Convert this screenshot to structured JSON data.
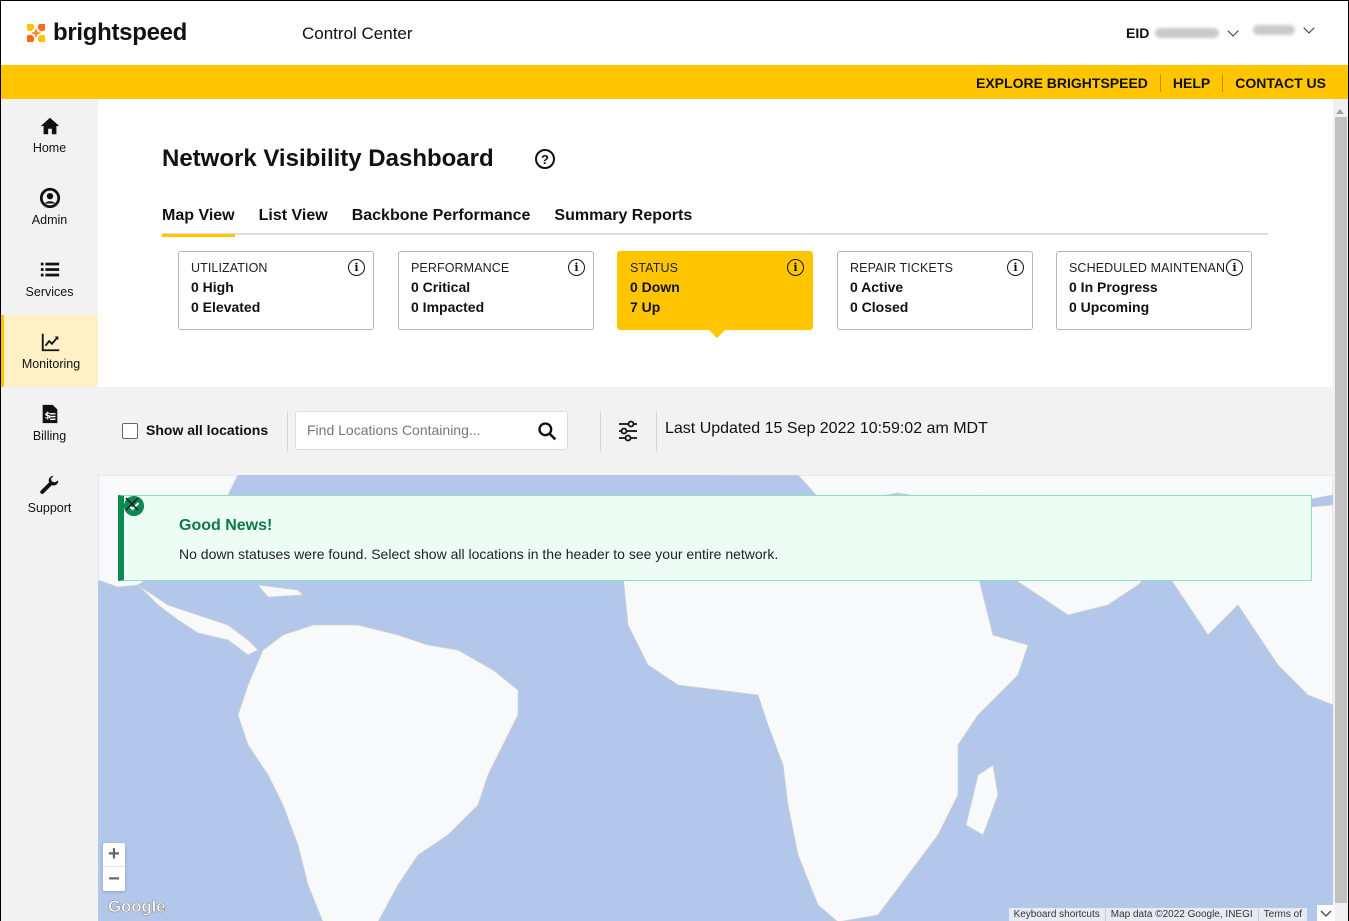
{
  "header": {
    "brand": "brightspeed",
    "app_title": "Control Center",
    "eid_label": "EID",
    "eid_value_redacted": true,
    "user_redacted": true
  },
  "utility_nav": {
    "links": [
      "EXPLORE BRIGHTSPEED",
      "HELP",
      "CONTACT US"
    ]
  },
  "sidebar": {
    "items": [
      {
        "label": "Home",
        "icon": "home-icon",
        "active": false
      },
      {
        "label": "Admin",
        "icon": "user-circle-icon",
        "active": false
      },
      {
        "label": "Services",
        "icon": "list-icon",
        "active": false
      },
      {
        "label": "Monitoring",
        "icon": "chart-trend-icon",
        "active": true
      },
      {
        "label": "Billing",
        "icon": "invoice-icon",
        "active": false
      },
      {
        "label": "Support",
        "icon": "wrench-icon",
        "active": false
      }
    ]
  },
  "page": {
    "title": "Network Visibility Dashboard",
    "help_icon": "?",
    "tabs": [
      {
        "label": "Map View",
        "active": true
      },
      {
        "label": "List View",
        "active": false
      },
      {
        "label": "Backbone Performance",
        "active": false
      },
      {
        "label": "Summary Reports",
        "active": false
      }
    ]
  },
  "cards": [
    {
      "title": "UTILIZATION",
      "lines": [
        "0 High",
        "0 Elevated"
      ],
      "active": false
    },
    {
      "title": "PERFORMANCE",
      "lines": [
        "0 Critical",
        "0 Impacted"
      ],
      "active": false
    },
    {
      "title": "STATUS",
      "lines": [
        "0 Down",
        "7 Up"
      ],
      "active": true
    },
    {
      "title": "REPAIR TICKETS",
      "lines": [
        "0 Active",
        "0 Closed"
      ],
      "active": false
    },
    {
      "title": "SCHEDULED MAINTENANCE",
      "lines": [
        "0 In Progress",
        "0 Upcoming"
      ],
      "active": false
    }
  ],
  "filters": {
    "show_all_label": "Show all locations",
    "show_all_checked": false,
    "search_placeholder": "Find Locations Containing...",
    "search_value": "",
    "last_updated": "Last Updated 15 Sep 2022 10:59:02 am MDT"
  },
  "alert": {
    "title": "Good News!",
    "message": "No down statuses were found. Select show all locations in the header to see your entire network."
  },
  "map": {
    "zoom_in": "+",
    "zoom_out": "−",
    "provider_logo": "Google",
    "attribution": [
      "Keyboard shortcuts",
      "Map data ©2022 Google, INEGI",
      "Terms of"
    ]
  },
  "colors": {
    "brand_yellow": "#ffc600",
    "success_green": "#0b8a52",
    "map_water": "#b3c7ea",
    "map_land": "#f8f9fa"
  }
}
